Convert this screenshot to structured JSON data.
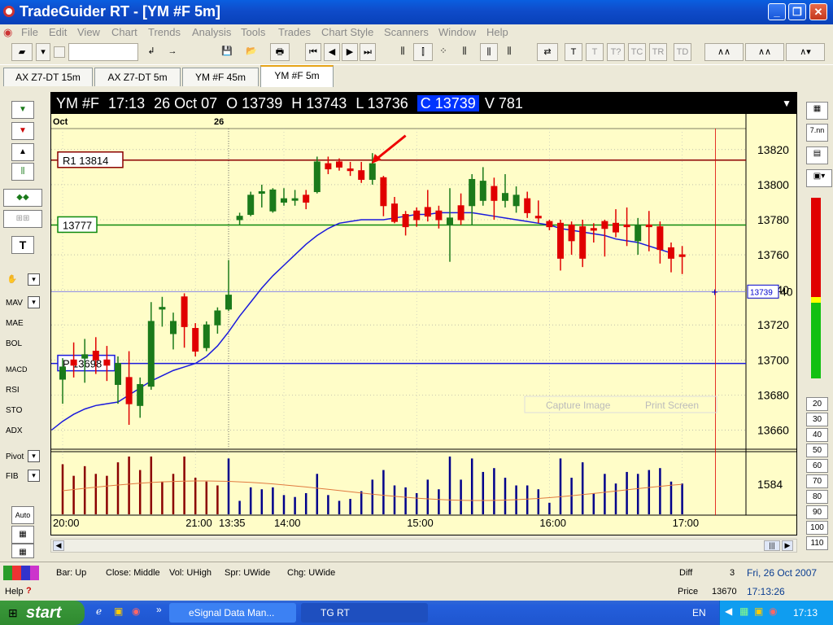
{
  "window": {
    "title": "TradeGuider RT  - [YM #F 5m]"
  },
  "menu": [
    "File",
    "Edit",
    "View",
    "Chart",
    "Trends",
    "Analysis",
    "Tools",
    "Trades",
    "Chart Style",
    "Scanners",
    "Window",
    "Help"
  ],
  "tabs": [
    "AX Z7-DT 15m",
    "AX Z7-DT 5m",
    "YM #F 45m",
    "YM #F 5m"
  ],
  "header": {
    "symbol": "YM #F",
    "time": "17:13",
    "date": "26 Oct 07",
    "open": "O 13739",
    "high": "H 13743",
    "low": "L 13736",
    "close": "C 13739",
    "volume": "V 781",
    "menu_arrow": "▼"
  },
  "chart": {
    "month_label": "Oct",
    "day_label": "26",
    "current_price_tag": "13739",
    "last_price_tick": "40"
  },
  "levels": {
    "r1": "R1 13814",
    "mid": "13777",
    "p": "P 13698"
  },
  "watermark": {
    "capture": "Capture Image",
    "print": "Print Screen"
  },
  "left_labels": {
    "mav": "MAV",
    "mae": "MAE",
    "bol": "BOL",
    "macd": "MACD",
    "rsi": "RSI",
    "sto": "STO",
    "adx": "ADX",
    "pivot": "Pivot",
    "fib": "FIB",
    "auto": "Auto",
    "text_tool": "T"
  },
  "right_buttons": [
    "20",
    "30",
    "40",
    "50",
    "60",
    "70",
    "80",
    "90",
    "100",
    "110"
  ],
  "right_top": {
    "nn": "7.nn"
  },
  "status": {
    "bar": "Bar: Up",
    "close": "Close: Middle",
    "vol": "Vol: UHigh",
    "spr": "Spr: UWide",
    "chg": "Chg: UWide",
    "help": "Help",
    "diff_label": "Diff",
    "diff_val": "3",
    "date": "Fri, 26 Oct 2007",
    "price_label": "Price",
    "price_val": "13670",
    "clock": "17:13:26"
  },
  "taskbar": {
    "start": "start",
    "task1": "eSignal Data Man...",
    "task2": "TG RT",
    "lang": "EN",
    "clock": "17:13"
  },
  "colors": {
    "chart_bg": "#fffdc8",
    "up": "#1b7a1b",
    "down": "#e00000",
    "ma": "#1a1adc",
    "r1": "#8b0000",
    "mid": "#0d8a0d",
    "pivot": "#1a1adc",
    "vol_down": "#8b0000",
    "vol_up": "#00008b"
  },
  "chart_data": {
    "type": "candlestick",
    "ylim": [
      13650,
      13832
    ],
    "y_ticks": [
      13820,
      13800,
      13780,
      13760,
      13740,
      13720,
      13700,
      13680,
      13660
    ],
    "x_ticks": [
      "20:00",
      "21:00",
      "13:35",
      "14:00",
      "15:00",
      "16:00",
      "17:00"
    ],
    "volume_label": "1584",
    "candles": [
      [
        "20:00",
        13689,
        13701,
        13675,
        13696
      ],
      [
        "20:05",
        13700,
        13710,
        13690,
        13697
      ],
      [
        "20:10",
        13701,
        13712,
        13687,
        13703
      ],
      [
        "20:15",
        13705,
        13713,
        13692,
        13700
      ],
      [
        "20:20",
        13700,
        13708,
        13688,
        13697
      ],
      [
        "20:25",
        13686,
        13702,
        13675,
        13698
      ],
      [
        "20:30",
        13690,
        13705,
        13663,
        13675
      ],
      [
        "20:35",
        13674,
        13690,
        13667,
        13686
      ],
      [
        "20:40",
        13685,
        13733,
        13683,
        13722
      ],
      [
        "20:45",
        13729,
        13736,
        13719,
        13730
      ],
      [
        "20:50",
        13715,
        13727,
        13706,
        13722
      ],
      [
        "20:55",
        13736,
        13738,
        13707,
        13719
      ],
      [
        "21:00",
        13718,
        13721,
        13702,
        13705
      ],
      [
        "21:05",
        13707,
        13722,
        13705,
        13720
      ],
      [
        "21:10",
        13720,
        13730,
        13715,
        13728
      ],
      [
        "13:35",
        13729,
        13757,
        13728,
        13737
      ],
      [
        "13:40",
        13780,
        13784,
        13777,
        13782
      ],
      [
        "13:45",
        13783,
        13796,
        13782,
        13794
      ],
      [
        "13:50",
        13796,
        13800,
        13787,
        13796
      ],
      [
        "13:55",
        13785,
        13798,
        13784,
        13797
      ],
      [
        "14:00",
        13790,
        13798,
        13788,
        13792
      ],
      [
        "14:05",
        13792,
        13797,
        13788,
        13792
      ],
      [
        "14:10",
        13794,
        13797,
        13786,
        13790
      ],
      [
        "14:15",
        13796,
        13816,
        13795,
        13813
      ],
      [
        "14:20",
        13812,
        13816,
        13806,
        13809
      ],
      [
        "14:25",
        13813,
        13815,
        13808,
        13810
      ],
      [
        "14:30",
        13809,
        13813,
        13805,
        13808
      ],
      [
        "14:35",
        13808,
        13813,
        13801,
        13803
      ],
      [
        "14:40",
        13803,
        13818,
        13800,
        13812
      ],
      [
        "14:45",
        13804,
        13805,
        13782,
        13788
      ],
      [
        "14:50",
        13789,
        13793,
        13778,
        13779
      ],
      [
        "14:55",
        13783,
        13785,
        13771,
        13776
      ],
      [
        "15:00",
        13785,
        13787,
        13776,
        13780
      ],
      [
        "15:05",
        13787,
        13797,
        13779,
        13782
      ],
      [
        "15:10",
        13785,
        13788,
        13775,
        13780
      ],
      [
        "15:15",
        13777,
        13798,
        13756,
        13781
      ],
      [
        "15:20",
        13788,
        13795,
        13777,
        13780
      ],
      [
        "15:25",
        13788,
        13806,
        13777,
        13803
      ],
      [
        "15:30",
        13791,
        13810,
        13788,
        13802
      ],
      [
        "15:35",
        13799,
        13804,
        13780,
        13791
      ],
      [
        "15:40",
        13791,
        13806,
        13787,
        13795
      ],
      [
        "15:45",
        13788,
        13799,
        13784,
        13794
      ],
      [
        "15:50",
        13792,
        13796,
        13781,
        13784
      ],
      [
        "15:55",
        13782,
        13791,
        13778,
        13781
      ],
      [
        "16:00",
        13779,
        13780,
        13774,
        13776
      ],
      [
        "16:05",
        13778,
        13780,
        13751,
        13758
      ],
      [
        "16:10",
        13777,
        13779,
        13760,
        13768
      ],
      [
        "16:15",
        13776,
        13780,
        13753,
        13758
      ],
      [
        "16:20",
        13775,
        13778,
        13767,
        13774
      ],
      [
        "16:25",
        13779,
        13780,
        13759,
        13775
      ],
      [
        "16:30",
        13778,
        13786,
        13770,
        13773
      ],
      [
        "16:35",
        13777,
        13787,
        13765,
        13776
      ],
      [
        "16:40",
        13768,
        13781,
        13760,
        13777
      ],
      [
        "16:45",
        13777,
        13785,
        13762,
        13776
      ],
      [
        "16:50",
        13776,
        13779,
        13755,
        13763
      ],
      [
        "16:55",
        13764,
        13767,
        13750,
        13758
      ],
      [
        "17:00",
        13760,
        13765,
        13749,
        13759
      ]
    ],
    "ma_line": [
      13660,
      13665,
      13669,
      13672,
      13674,
      13675,
      13676,
      13680,
      13684,
      13688,
      13691,
      13694,
      13696,
      13698,
      13702,
      13708,
      13716,
      13725,
      13733,
      13741,
      13748,
      13754,
      13760,
      13766,
      13771,
      13775,
      13778,
      13779,
      13780,
      13780,
      13780,
      13781,
      13782,
      13783,
      13783,
      13784,
      13784,
      13784,
      13784,
      13783,
      13782,
      13781,
      13780,
      13779,
      13778,
      13777,
      13775,
      13774,
      13773,
      13772,
      13771,
      13769,
      13768,
      13767,
      13765,
      13763,
      13761
    ],
    "levels": {
      "r1": 13814,
      "mid": 13777,
      "pivot": 13698,
      "last": 13739
    }
  }
}
